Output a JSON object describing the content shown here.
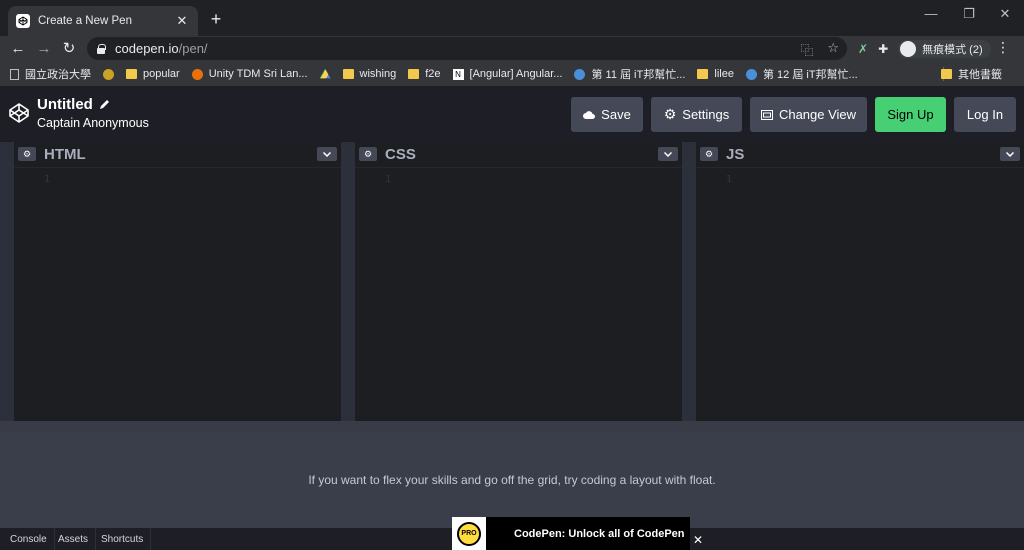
{
  "browser": {
    "tab_title": "Create a New Pen",
    "tab_close": "✕",
    "new_tab": "+",
    "url_host": "codepen.io",
    "url_path": "/pen/",
    "incognito_label": "無痕模式 (2)",
    "bookmarks": [
      {
        "label": "國立政治大學",
        "icon": "page"
      },
      {
        "label": "",
        "icon": "extension-icon"
      },
      {
        "label": "popular",
        "icon": "folder"
      },
      {
        "label": "Unity TDM Sri Lan...",
        "icon": "site"
      },
      {
        "label": "",
        "icon": "drive-icon"
      },
      {
        "label": "wishing",
        "icon": "folder"
      },
      {
        "label": "f2e",
        "icon": "folder"
      },
      {
        "label": "[Angular] Angular...",
        "icon": "notion"
      },
      {
        "label": "第 11 屆 iT邦幫忙...",
        "icon": "ithome"
      },
      {
        "label": "lilee",
        "icon": "folder"
      },
      {
        "label": "第 12 屆 iT邦幫忙...",
        "icon": "ithome"
      }
    ],
    "bookmarks_other": "其他書籤"
  },
  "codepen": {
    "title": "Untitled",
    "author": "Captain Anonymous",
    "save_label": "Save",
    "settings_label": "Settings",
    "change_view_label": "Change View",
    "signup_label": "Sign Up",
    "login_label": "Log In",
    "editors": [
      {
        "label": "HTML",
        "line": "1"
      },
      {
        "label": "CSS",
        "line": "1"
      },
      {
        "label": "JS",
        "line": "1"
      }
    ],
    "preview_message": "If you want to flex your skills and go off the grid, try coding a layout with float.",
    "footer": {
      "console": "Console",
      "assets": "Assets",
      "shortcuts": "Shortcuts"
    },
    "promo": {
      "badge": "PRO",
      "text": "CodePen: Unlock all of CodePen",
      "close": "✕"
    }
  },
  "colors": {
    "signup": "#47cf73",
    "button": "#444857",
    "header_bg": "#1e1f26",
    "editor_bg": "#1d1e22"
  }
}
